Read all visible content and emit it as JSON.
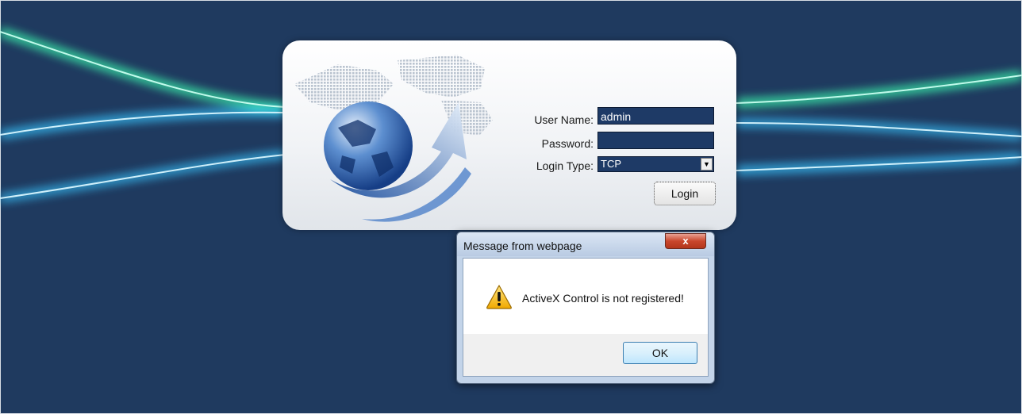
{
  "login": {
    "username_label": "User Name:",
    "username_value": "admin",
    "password_label": "Password:",
    "password_value": "",
    "login_type_label": "Login Type:",
    "login_type_value": "TCP",
    "login_button": "Login"
  },
  "dialog": {
    "title": "Message from webpage",
    "close_glyph": "x",
    "message": "ActiveX Control is not registered!",
    "ok_button": "OK",
    "icon": "warning-icon"
  },
  "colors": {
    "background": "#1f3a5f",
    "field_background": "#1e3a66",
    "streak_green": "#3dffb0",
    "streak_blue": "#39c6ff"
  }
}
